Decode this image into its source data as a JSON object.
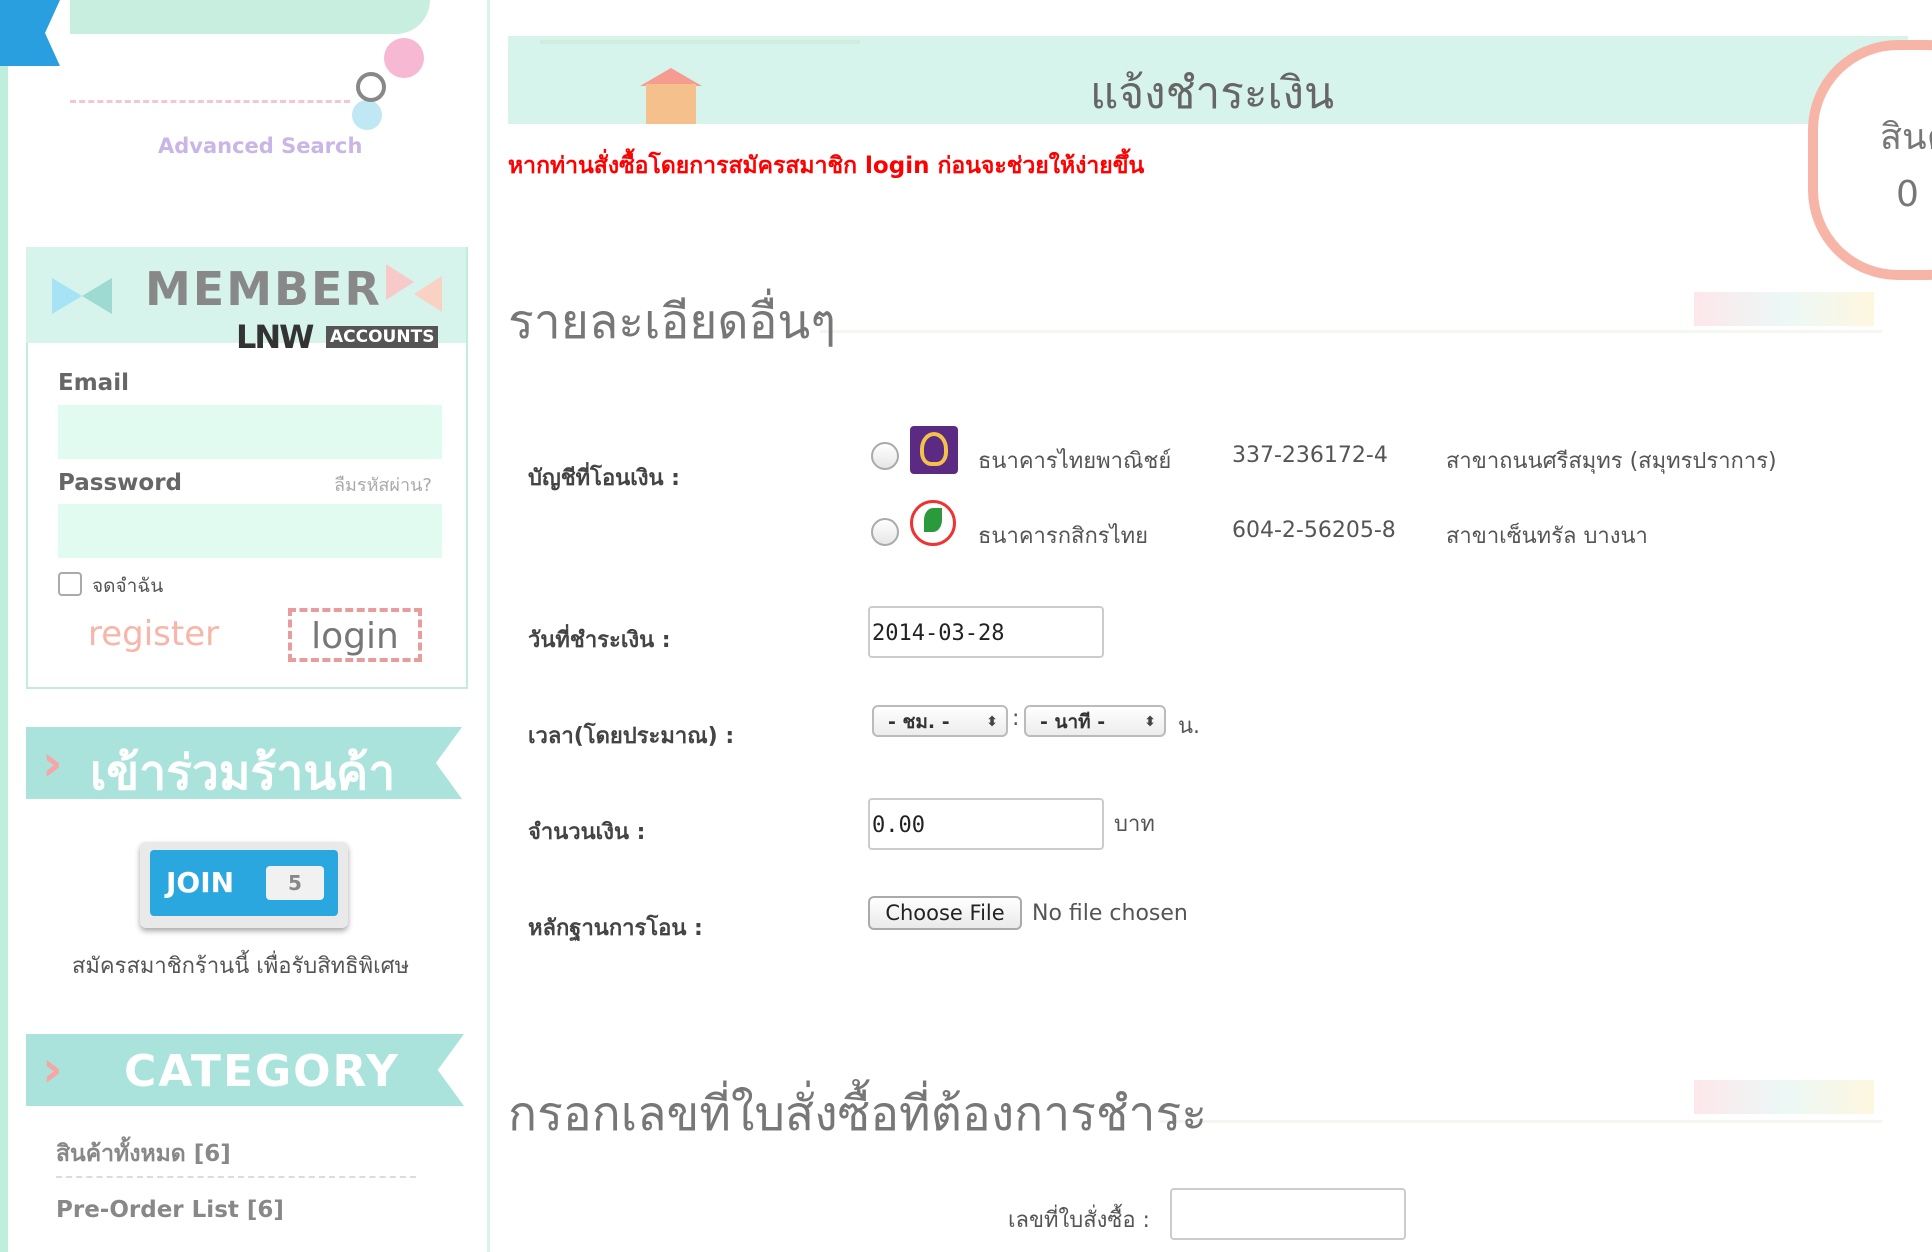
{
  "sidebar": {
    "advanced_search": "Advanced Search",
    "member": {
      "title": "MEMBER",
      "brand": "LNW",
      "accounts_label": "ACCOUNTS",
      "email_label": "Email",
      "email_value": "",
      "password_label": "Password",
      "password_value": "",
      "forgot_label": "ลืมรหัสผ่าน?",
      "remember_label": "จดจำฉัน",
      "register_label": "register",
      "login_label": "login"
    },
    "join": {
      "title": "เข้าร่วมร้านค้า",
      "button_label": "JOIN",
      "count": "5",
      "description": "สมัครสมาชิกร้านนี้ เพื่อรับสิทธิพิเศษ"
    },
    "category": {
      "title": "CATEGORY",
      "items": [
        {
          "label": "สินค้าทั้งหมด [6]"
        },
        {
          "label": "Pre-Order List [6]"
        }
      ]
    }
  },
  "main": {
    "header_title": "แจ้งชำระเงิน",
    "cart_label": "สินค",
    "cart_count": "0",
    "warning": "หากท่านสั่งซื้อโดยการสมัครสมาชิก login ก่อนจะช่วยให้ง่ายขึ้น",
    "section_details": "รายละเอียดอื่นๆ",
    "form": {
      "account_label": "บัญชีที่โอนเงิน :",
      "banks": [
        {
          "name": "ธนาคารไทยพาณิชย์",
          "account": "337-236172-4",
          "branch": "สาขาถนนศรีสมุทร (สมุทรปราการ)",
          "icon": "scb-logo-icon"
        },
        {
          "name": "ธนาคารกสิกรไทย",
          "account": "604-2-56205-8",
          "branch": "สาขาเซ็นทรัล บางนา",
          "icon": "kbank-logo-icon"
        }
      ],
      "date_label": "วันที่ชำระเงิน :",
      "date_value": "2014-03-28",
      "time_label": "เวลา(โดยประมาณ) :",
      "hour_selected": "- ชม. -",
      "minute_selected": "- นาที -",
      "time_sep": ":",
      "time_unit": "น.",
      "amount_label": "จำนวนเงิน :",
      "amount_value": "0.00",
      "amount_unit": "บาท",
      "proof_label": "หลักฐานการโอน :",
      "file_button": "Choose File",
      "file_status": "No file chosen"
    },
    "section_order": "กรอกเลขที่ใบสั่งซื้อที่ต้องการชำระ",
    "order_label": "เลขที่ใบสั่งซื้อ :",
    "order_value": ""
  },
  "colors": {
    "mint": "#d6f4ec",
    "input_mint": "#e1fbf1",
    "warning_red": "#ff0000",
    "join_blue": "#2ba7e0",
    "scb_purple": "#5b2a82",
    "kbank_green": "#2a9a3c"
  }
}
